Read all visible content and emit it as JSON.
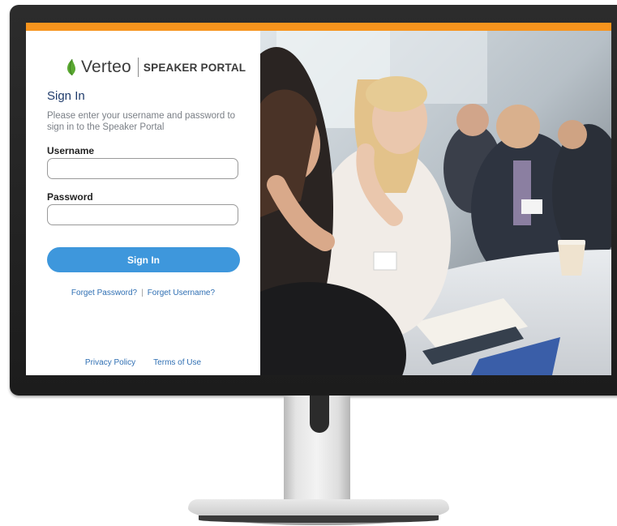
{
  "brand": {
    "name": "Verteo",
    "portal": "SPEAKER PORTAL"
  },
  "signin": {
    "title": "Sign In",
    "description": "Please enter your username and password to sign in to the Speaker Portal",
    "username_label": "Username",
    "username_value": "",
    "password_label": "Password",
    "password_value": "",
    "button_label": "Sign In"
  },
  "links": {
    "forgot_password": "Forget Password?",
    "divider": "|",
    "forgot_username": "Forget Username?",
    "privacy": "Privacy Policy",
    "terms": "Terms of Use"
  },
  "colors": {
    "accent_bar": "#f7941d",
    "button": "#3e97dc",
    "title": "#1f3b6b",
    "link": "#2f6fb3",
    "leaf": "#5aa832"
  },
  "photo": {
    "subject": "conference attendees seated at a table"
  }
}
